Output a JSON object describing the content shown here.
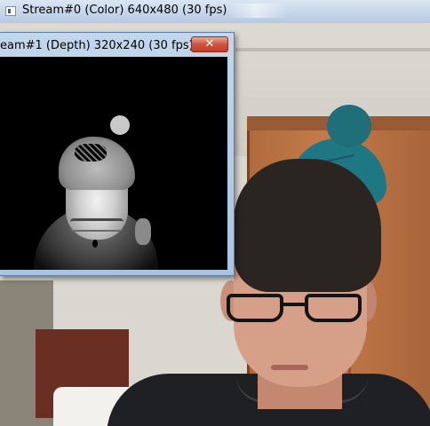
{
  "color_window": {
    "title": "Stream#0 (Color) 640x480 (30 fps)",
    "icon": "window-app-icon"
  },
  "depth_window": {
    "title": "eam#1 (Depth) 320x240 (30 fps)",
    "close_icon": "close-icon",
    "close_glyph": "✕"
  },
  "colors": {
    "titlebar": "#c6d6ea",
    "close_button": "#d0533b",
    "depth_background": "#000000"
  }
}
